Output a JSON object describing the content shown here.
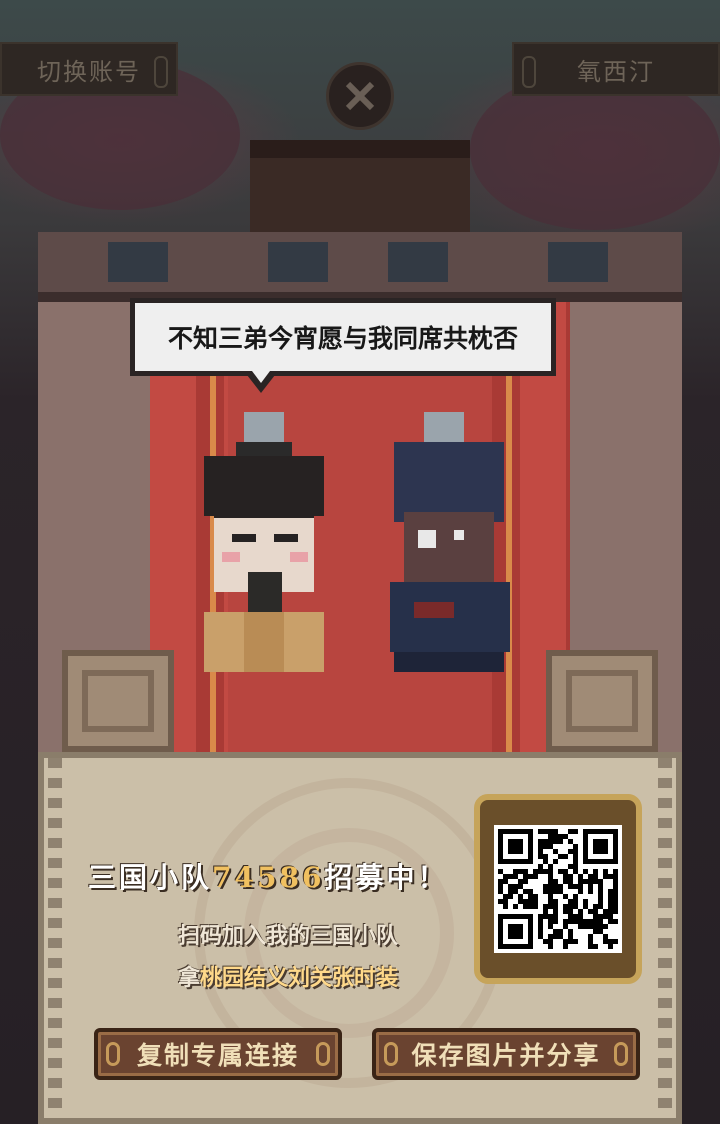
{
  "top_bar": {
    "switch_account_label": "切换账号",
    "server_name": "氧西汀",
    "close_icon": "close-x-icon"
  },
  "share_card": {
    "speech_text": "不知三弟今宵愿与我同席共枕否",
    "recruit_prefix": "三国小队",
    "team_id": "74586",
    "recruit_suffix": "招募中！",
    "line1": "扫码加入我的三国小队",
    "line2_prefix": "拿",
    "line2_highlight": "桃园结义刘关张时装",
    "qr_icon": "qr-code-icon",
    "copy_button_label": "复制专属连接",
    "save_button_label": "保存图片并分享"
  },
  "colors": {
    "accent_gold": "#f0c060",
    "button_brown": "#6a4330",
    "curtain_red": "#c24a43"
  }
}
